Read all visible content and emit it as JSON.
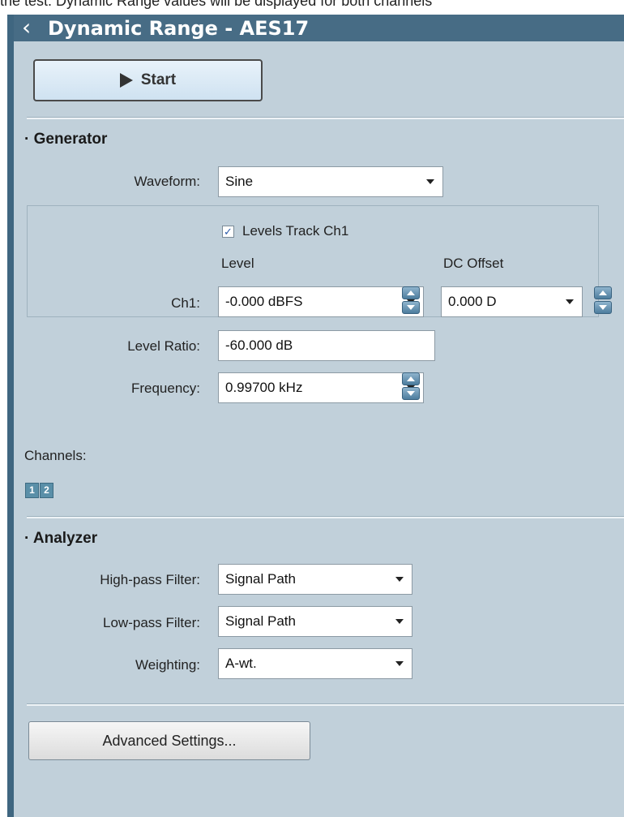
{
  "caption": "the test. Dynamic Range values will be displayed for both channels",
  "header": {
    "title": "Dynamic Range - AES17"
  },
  "start_button": {
    "label": "Start"
  },
  "generator": {
    "heading": "Generator",
    "waveform": {
      "label": "Waveform:",
      "value": "Sine"
    },
    "levels_track": {
      "label": "Levels Track Ch1",
      "checked": true
    },
    "level_header": "Level",
    "dc_offset_header": "DC Offset",
    "ch1": {
      "label": "Ch1:",
      "level": "-0.000 dBFS",
      "dc_offset": "0.000 D"
    },
    "level_ratio": {
      "label": "Level Ratio:",
      "value": "-60.000 dB"
    },
    "frequency": {
      "label": "Frequency:",
      "value": "0.99700 kHz"
    },
    "channels": {
      "label": "Channels:",
      "items": [
        "1",
        "2"
      ]
    }
  },
  "analyzer": {
    "heading": "Analyzer",
    "high_pass": {
      "label": "High-pass Filter:",
      "value": "Signal Path"
    },
    "low_pass": {
      "label": "Low-pass Filter:",
      "value": "Signal Path"
    },
    "weighting": {
      "label": "Weighting:",
      "value": "A-wt."
    }
  },
  "advanced_button": {
    "label": "Advanced Settings..."
  }
}
